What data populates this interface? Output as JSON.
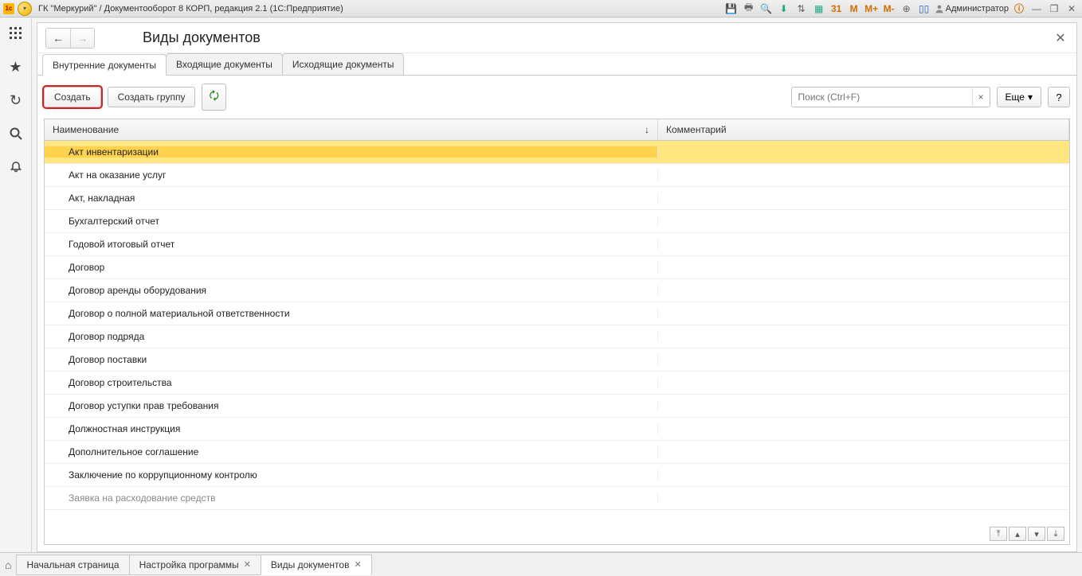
{
  "titlebar": {
    "app_title": "ГК \"Меркурий\" / Документооборот 8 КОРП, редакция 2.1  (1С:Предприятие)",
    "user_label": "Администратор",
    "m_label": "M",
    "mplus_label": "M+",
    "mminus_label": "M-",
    "calendar_day": "31"
  },
  "vsb": {
    "apps": "apps",
    "star": "star",
    "history": "history",
    "search": "search",
    "bell": "bell"
  },
  "page": {
    "title": "Виды документов",
    "close": "×"
  },
  "tabs": [
    {
      "label": "Внутренние документы",
      "active": true
    },
    {
      "label": "Входящие документы",
      "active": false
    },
    {
      "label": "Исходящие документы",
      "active": false
    }
  ],
  "toolbar": {
    "create_label": "Создать",
    "create_group_label": "Создать группу",
    "search_placeholder": "Поиск (Ctrl+F)",
    "more_label": "Еще",
    "help_label": "?"
  },
  "table": {
    "columns": {
      "name": "Наименование",
      "comment": "Комментарий"
    },
    "rows": [
      {
        "name": "Акт инвентаризации",
        "comment": "",
        "selected": true
      },
      {
        "name": "Акт на оказание услуг",
        "comment": ""
      },
      {
        "name": "Акт, накладная",
        "comment": ""
      },
      {
        "name": "Бухгалтерский отчет",
        "comment": ""
      },
      {
        "name": "Годовой итоговый отчет",
        "comment": ""
      },
      {
        "name": "Договор",
        "comment": ""
      },
      {
        "name": "Договор аренды оборудования",
        "comment": ""
      },
      {
        "name": "Договор о полной материальной ответственности",
        "comment": ""
      },
      {
        "name": "Договор подряда",
        "comment": ""
      },
      {
        "name": "Договор поставки",
        "comment": ""
      },
      {
        "name": "Договор строительства",
        "comment": ""
      },
      {
        "name": "Договор уступки прав требования",
        "comment": ""
      },
      {
        "name": "Должностная инструкция",
        "comment": ""
      },
      {
        "name": "Дополнительное соглашение",
        "comment": ""
      },
      {
        "name": "Заключение по коррупционному контролю",
        "comment": ""
      },
      {
        "name": "Заявка на расходование средств",
        "comment": "",
        "cutoff": true
      }
    ]
  },
  "winbar": {
    "tabs": [
      {
        "label": "Начальная страница",
        "closable": false,
        "active": false
      },
      {
        "label": "Настройка программы",
        "closable": true,
        "active": false
      },
      {
        "label": "Виды документов",
        "closable": true,
        "active": true
      }
    ]
  }
}
